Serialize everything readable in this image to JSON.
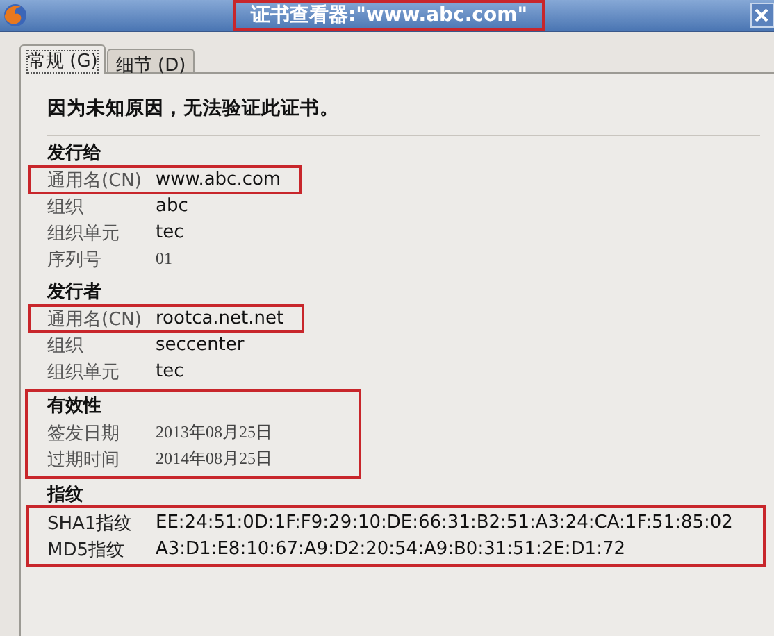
{
  "window": {
    "title": "证书查看器:\"www.abc.com\"",
    "title_highlighted": true
  },
  "tabs": [
    {
      "label": "常规 (G)",
      "selected": true
    },
    {
      "label": "细节 (D)",
      "selected": false
    }
  ],
  "message": "因为未知原因，无法验证此证书。",
  "sections": [
    {
      "title": "发行给",
      "highlighted": false,
      "rows_highlighted": false,
      "rows": [
        {
          "label": "通用名(CN)",
          "value": "www.abc.com",
          "kind": "text",
          "highlighted": true
        },
        {
          "label": "组织",
          "value": "abc",
          "kind": "text",
          "highlighted": false
        },
        {
          "label": "组织单元",
          "value": "tec",
          "kind": "text",
          "highlighted": false
        },
        {
          "label": "序列号",
          "value": "01",
          "kind": "serif",
          "highlighted": false
        }
      ]
    },
    {
      "title": "发行者",
      "highlighted": false,
      "rows_highlighted": false,
      "rows": [
        {
          "label": "通用名(CN)",
          "value": "rootca.net.net",
          "kind": "text",
          "highlighted": true
        },
        {
          "label": "组织",
          "value": "seccenter",
          "kind": "text",
          "highlighted": false
        },
        {
          "label": "组织单元",
          "value": "tec",
          "kind": "text",
          "highlighted": false
        }
      ]
    },
    {
      "title": "有效性",
      "highlighted": true,
      "rows_highlighted": false,
      "rows": [
        {
          "label": "签发日期",
          "value": "2013年08月25日",
          "kind": "serif",
          "highlighted": false
        },
        {
          "label": "过期时间",
          "value": "2014年08月25日",
          "kind": "serif",
          "highlighted": false
        }
      ]
    },
    {
      "title": "指纹",
      "highlighted": false,
      "rows_highlighted": true,
      "rows": [
        {
          "label": "SHA1指纹",
          "value": "EE:24:51:0D:1F:F9:29:10:DE:66:31:B2:51:A3:24:CA:1F:51:85:02",
          "kind": "text",
          "highlighted": false
        },
        {
          "label": "MD5指纹",
          "value": "A3:D1:E8:10:67:A9:D2:20:54:A9:B0:31:51:2E:D1:72",
          "kind": "text",
          "highlighted": false
        }
      ]
    }
  ]
}
